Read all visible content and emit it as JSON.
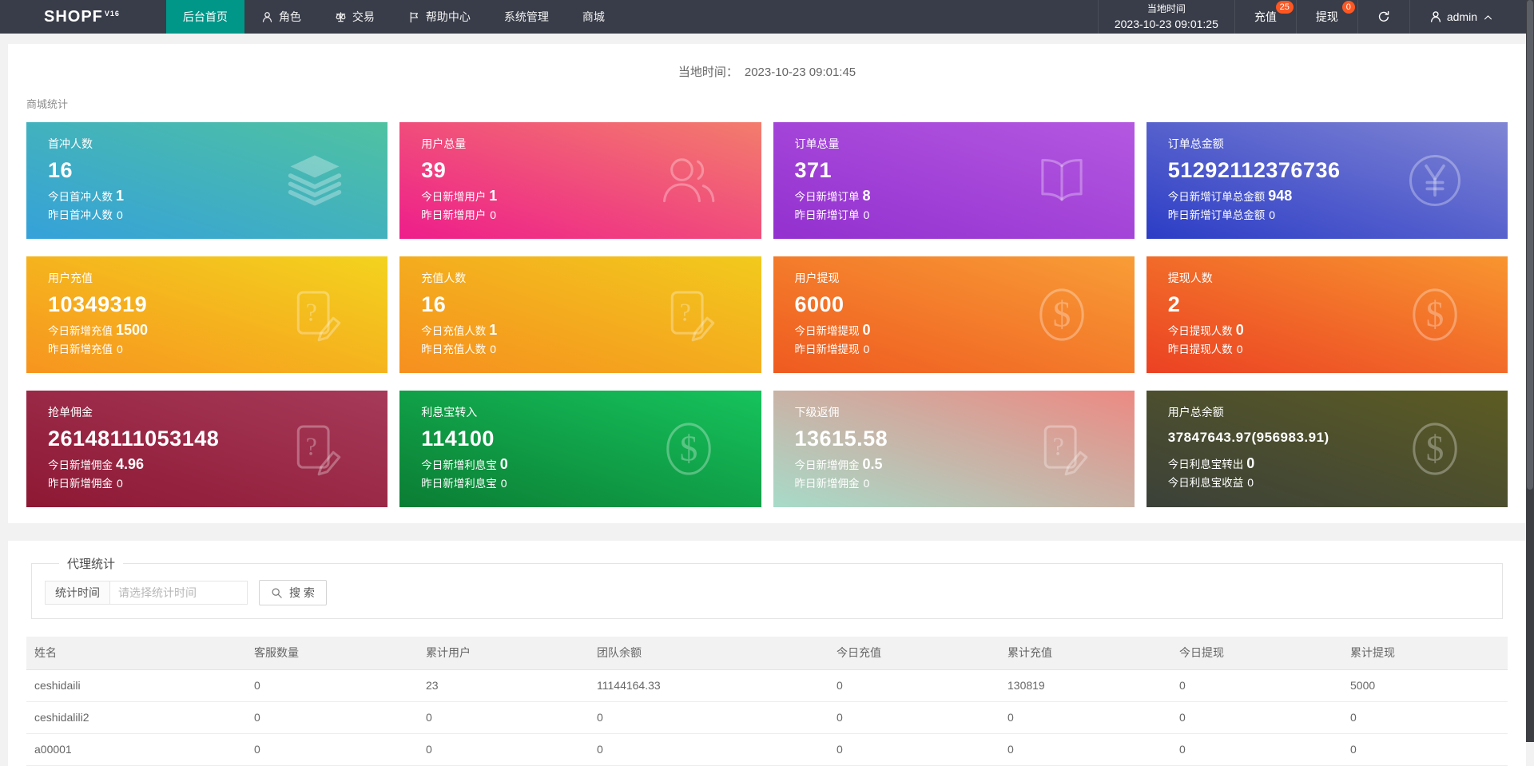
{
  "navbar": {
    "logo_text": "SHOPF",
    "logo_version": "V16",
    "menu": [
      {
        "id": "home",
        "label": "后台首页",
        "active": true,
        "icon": null
      },
      {
        "id": "roles",
        "label": "角色",
        "active": false,
        "icon": "user-icon"
      },
      {
        "id": "trade",
        "label": "交易",
        "active": false,
        "icon": "scales-icon"
      },
      {
        "id": "help",
        "label": "帮助中心",
        "active": false,
        "icon": "flag-icon"
      },
      {
        "id": "system",
        "label": "系统管理",
        "active": false,
        "icon": null
      },
      {
        "id": "mall",
        "label": "商城",
        "active": false,
        "icon": null
      }
    ],
    "local_time_label": "当地时间",
    "local_time_value": "2023-10-23 09:01:25",
    "recharge_label": "充值",
    "recharge_badge": "25",
    "withdraw_label": "提现",
    "withdraw_badge": "0",
    "user": "admin"
  },
  "main": {
    "time_label": "当地时间：",
    "time_value": "2023-10-23 09:01:45",
    "section_title": "商城统计",
    "cards": [
      {
        "id": "first-charge-users",
        "title": "首冲人数",
        "value": "16",
        "line2_label": "今日首冲人数",
        "line2_value": "1",
        "line3_label": "昨日首冲人数",
        "line3_value": "0",
        "icon": "layers-icon",
        "gradient": [
          "#35a1da",
          "#4fc2a1"
        ]
      },
      {
        "id": "total-users",
        "title": "用户总量",
        "value": "39",
        "line2_label": "今日新增用户",
        "line2_value": "1",
        "line3_label": "昨日新增用户",
        "line3_value": "0",
        "icon": "users-icon",
        "gradient": [
          "#ee1d8b",
          "#f37d6c"
        ]
      },
      {
        "id": "total-orders",
        "title": "订单总量",
        "value": "371",
        "line2_label": "今日新增订单",
        "line2_value": "8",
        "line3_label": "昨日新增订单",
        "line3_value": "0",
        "icon": "book-icon",
        "gradient": [
          "#9330cf",
          "#b458e1"
        ]
      },
      {
        "id": "order-total-amount",
        "title": "订单总金额",
        "value": "51292112376736",
        "line2_label": "今日新增订单总金额",
        "line2_value": "948",
        "line3_label": "昨日新增订单总金额",
        "line3_value": "0",
        "icon": "yen-circle-icon",
        "gradient": [
          "#2c3dc6",
          "#8085d4"
        ]
      },
      {
        "id": "user-recharge",
        "title": "用户充值",
        "value": "10349319",
        "line2_label": "今日新增充值",
        "line2_value": "1500",
        "line3_label": "昨日新增充值",
        "line3_value": "0",
        "icon": "doc-edit-icon",
        "gradient": [
          "#f7941f",
          "#f3d31e"
        ]
      },
      {
        "id": "recharge-users",
        "title": "充值人数",
        "value": "16",
        "line2_label": "今日充值人数",
        "line2_value": "1",
        "line3_label": "昨日充值人数",
        "line3_value": "0",
        "icon": "doc-edit-icon",
        "gradient": [
          "#f68f1f",
          "#f2ca1d"
        ]
      },
      {
        "id": "user-withdraw",
        "title": "用户提现",
        "value": "6000",
        "line2_label": "今日新增提现",
        "line2_value": "0",
        "line3_label": "昨日新增提现",
        "line3_value": "0",
        "icon": "dollar-circle-icon",
        "gradient": [
          "#ef5a20",
          "#f89d36"
        ]
      },
      {
        "id": "withdraw-users",
        "title": "提现人数",
        "value": "2",
        "line2_label": "今日提现人数",
        "line2_value": "0",
        "line3_label": "昨日提现人数",
        "line3_value": "0",
        "icon": "dollar-circle-icon",
        "gradient": [
          "#eb4123",
          "#f8952f"
        ]
      },
      {
        "id": "order-commission",
        "title": "抢单佣金",
        "value": "26148111053148",
        "line2_label": "今日新增佣金",
        "line2_value": "4.96",
        "line3_label": "昨日新增佣金",
        "line3_value": "0",
        "icon": "doc-edit-icon",
        "gradient": [
          "#8d1834",
          "#a63a59"
        ]
      },
      {
        "id": "interest-transfer-in",
        "title": "利息宝转入",
        "value": "114100",
        "line2_label": "今日新增利息宝",
        "line2_value": "0",
        "line3_label": "昨日新增利息宝",
        "line3_value": "0",
        "icon": "dollar-circle-icon",
        "gradient": [
          "#0b7d34",
          "#16c35c"
        ]
      },
      {
        "id": "sub-rebate",
        "title": "下级返佣",
        "value": "13615.58",
        "line2_label": "今日新增佣金",
        "line2_value": "0.5",
        "line3_label": "昨日新增佣金",
        "line3_value": "0",
        "icon": "doc-edit-icon",
        "gradient": [
          "#a7dbc9",
          "#ec8a83"
        ]
      },
      {
        "id": "user-total-balance",
        "title": "用户总余额",
        "value": "37847643.97(956983.91)",
        "value_small": true,
        "line2_label": "今日利息宝转出",
        "line2_value": "0",
        "line3_label": "今日利息宝收益",
        "line3_value": "0",
        "icon": "dollar-circle-icon",
        "gradient": [
          "#3b4139",
          "#5d5c23"
        ]
      }
    ]
  },
  "agent": {
    "legend": "代理统计",
    "time_field_label": "统计时间",
    "time_placeholder": "请选择统计时间",
    "search_label": "搜 索",
    "table": {
      "headers": [
        "姓名",
        "客服数量",
        "累计用户",
        "团队余额",
        "今日充值",
        "累计充值",
        "今日提现",
        "累计提现"
      ],
      "rows": [
        [
          "ceshidaili",
          "0",
          "23",
          "11144164.33",
          "0",
          "130819",
          "0",
          "5000"
        ],
        [
          "ceshidalili2",
          "0",
          "0",
          "0",
          "0",
          "0",
          "0",
          "0"
        ],
        [
          "a00001",
          "0",
          "0",
          "0",
          "0",
          "0",
          "0",
          "0"
        ]
      ]
    }
  },
  "colors": {
    "navbar_bg": "#393D49",
    "accent_teal": "#009688",
    "badge_red": "#FF5722",
    "page_bg": "#f2f2f2"
  }
}
